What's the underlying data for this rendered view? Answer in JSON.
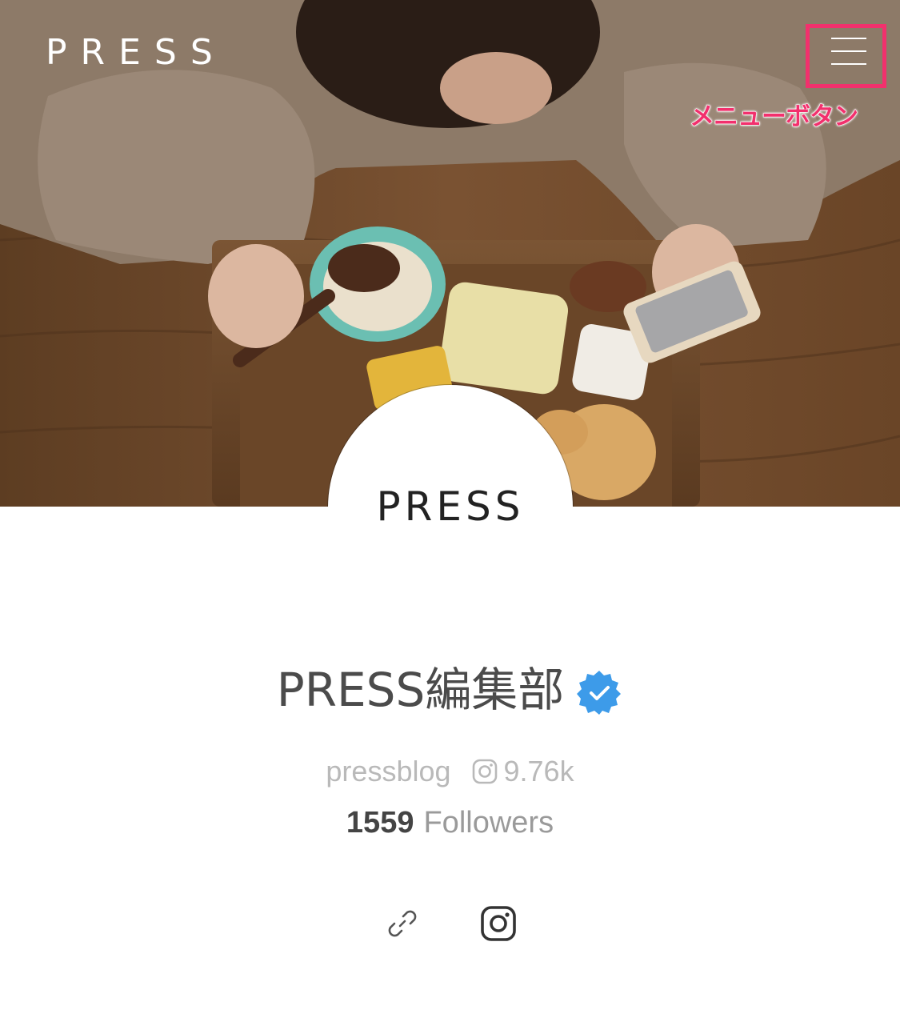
{
  "header": {
    "logo_text": "PRESS",
    "menu_icon": "hamburger-menu-icon",
    "annotation_text": "メニューボタン",
    "annotation_color": "#f2306d"
  },
  "hero": {
    "image_description_icon": "photo-cover-image"
  },
  "profile": {
    "avatar_text": "PRESS",
    "name": "PRESS編集部",
    "verified_icon": "verified-badge-icon",
    "verified_color": "#3d9be9",
    "handle": "pressblog",
    "instagram_count": "9.76k",
    "followers_count": "1559",
    "followers_label": "Followers"
  },
  "social": {
    "items": [
      {
        "icon": "link-icon"
      },
      {
        "icon": "instagram-icon"
      }
    ]
  }
}
